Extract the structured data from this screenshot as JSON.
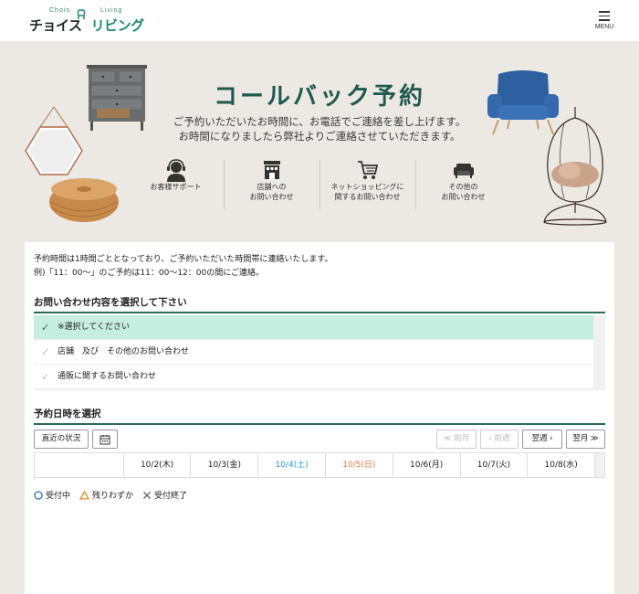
{
  "header": {
    "logo_small_left": "Chois",
    "logo_small_right": "Living",
    "logo_text_left": "チョイス",
    "logo_text_right": "リビング",
    "menu_label": "MENU"
  },
  "hero": {
    "title": "コールバック予約",
    "subtitle_line1": "ご予約いただいたお時間に、お電話でご連絡を差し上げます。",
    "subtitle_line2": "お時間になりましたら弊社よりご連絡させていただきます。",
    "categories": [
      {
        "icon": "headset-support-icon",
        "lines": [
          "お客様サポート",
          ""
        ]
      },
      {
        "icon": "store-icon",
        "lines": [
          "店舗への",
          "お問い合わせ"
        ]
      },
      {
        "icon": "shopping-cart-icon",
        "lines": [
          "ネットショッピングに",
          "関するお問い合わせ"
        ]
      },
      {
        "icon": "sofa-icon",
        "lines": [
          "その他の",
          "お問い合わせ"
        ]
      }
    ]
  },
  "intro": {
    "line1": "予約時間は1時間ごととなっており、ご予約いただいた時間帯に連絡いたします。",
    "line2": "例)「11：00〜」のご予約は11：00〜12：00の間にご連絡。"
  },
  "inquiry": {
    "title": "お問い合わせ内容を選択して下さい",
    "options": [
      {
        "label": "※選択してください",
        "selected": true
      },
      {
        "label": "店舗　及び　その他のお問い合わせ",
        "selected": false
      },
      {
        "label": "通販に関するお問い合わせ",
        "selected": false
      }
    ]
  },
  "schedule": {
    "title": "予約日時を選択",
    "recent_label": "直近の状況",
    "prev_month": "≪ 前月",
    "prev_week": "‹ 前週",
    "next_week": "翌週 ›",
    "next_month": "翌月 ≫",
    "days": [
      "10/2(木)",
      "10/3(金)",
      "10/4(土)",
      "10/5(日)",
      "10/6(月)",
      "10/7(火)",
      "10/8(水)"
    ]
  },
  "legend": {
    "available": "受付中",
    "few": "残りわずか",
    "closed": "受付終了"
  },
  "colors": {
    "accent": "#2a6a5a",
    "selected_bg": "#c5ede0",
    "saturday": "#2b9bd1",
    "sunday": "#e8773e",
    "hero_bg": "#ece8e3"
  }
}
